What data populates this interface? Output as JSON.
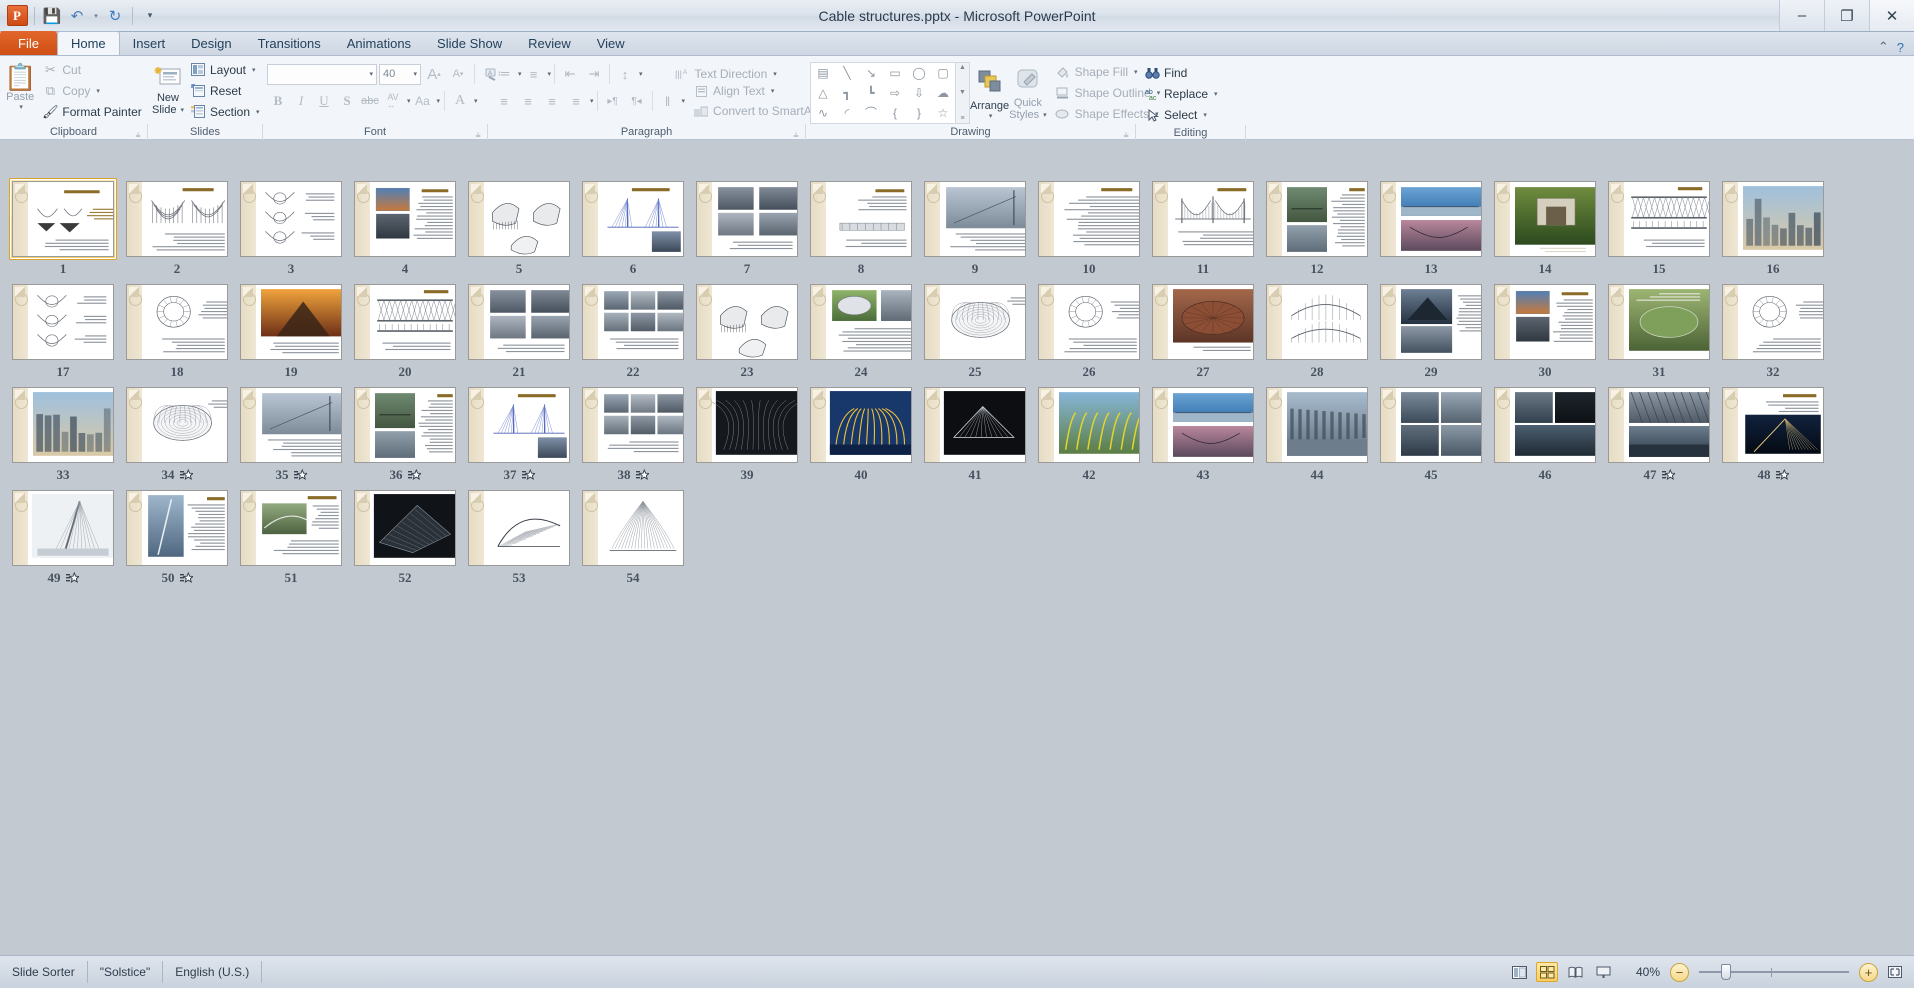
{
  "window": {
    "title": "Cable structures.pptx  -  Microsoft PowerPoint",
    "minimize": "–",
    "restore": "❐",
    "close": "✕"
  },
  "quick_access": {
    "logo": "P",
    "save": "💾",
    "undo": "↶",
    "undo_caret": "▾",
    "redo": "↻",
    "customize": "▾"
  },
  "tabs": [
    {
      "label": "File",
      "type": "file"
    },
    {
      "label": "Home",
      "type": "active"
    },
    {
      "label": "Insert",
      "type": "normal"
    },
    {
      "label": "Design",
      "type": "normal"
    },
    {
      "label": "Transitions",
      "type": "normal"
    },
    {
      "label": "Animations",
      "type": "normal"
    },
    {
      "label": "Slide Show",
      "type": "normal"
    },
    {
      "label": "Review",
      "type": "normal"
    },
    {
      "label": "View",
      "type": "normal"
    }
  ],
  "tab_right": {
    "help": "?",
    "minimize_ribbon": "⌃"
  },
  "ribbon": {
    "clipboard": {
      "group_label": "Clipboard",
      "dialog_launcher": "⫨",
      "paste": {
        "label": "Paste",
        "icon": "📋",
        "caret": "▾"
      },
      "cut": {
        "label": "Cut",
        "icon": "✂"
      },
      "copy": {
        "label": "Copy",
        "icon": "⧉",
        "caret": "▾"
      },
      "format_painter": {
        "label": "Format Painter",
        "icon": "🖌"
      }
    },
    "slides": {
      "group_label": "Slides",
      "new_slide": {
        "label_line1": "New",
        "label_line2": "Slide",
        "caret": "▾"
      },
      "layout": {
        "label": "Layout",
        "caret": "▾"
      },
      "reset": {
        "label": "Reset"
      },
      "section": {
        "label": "Section",
        "caret": "▾"
      }
    },
    "font": {
      "group_label": "Font",
      "dialog_launcher": "⫨",
      "font_name_value": "",
      "font_name_caret": "▾",
      "font_size_value": "40",
      "font_size_caret": "▾",
      "grow_font": "A↑",
      "shrink_font": "A↓",
      "clear_formatting": "⌫",
      "bold": "B",
      "italic": "I",
      "underline": "U",
      "shadow": "S",
      "strikethrough": "abc",
      "character_spacing": "AV",
      "change_case": "Aa",
      "font_color": "A"
    },
    "paragraph": {
      "group_label": "Paragraph",
      "dialog_launcher": "⫨",
      "bullets": "≔",
      "numbering": "≡",
      "decrease_indent": "⇤",
      "increase_indent": "⇥",
      "line_spacing": "↕",
      "align_left": "≡",
      "align_center": "≡",
      "align_right": "≡",
      "justify": "≡",
      "text_direction_ltr": "▸¶",
      "text_direction_rtl": "¶◂",
      "columns": "‖",
      "text_direction": {
        "label": "Text Direction",
        "caret": "▾"
      },
      "align_text": {
        "label": "Align Text",
        "caret": "▾"
      },
      "convert_smartart": {
        "label": "Convert to SmartArt",
        "caret": "▾"
      }
    },
    "drawing": {
      "group_label": "Drawing",
      "dialog_launcher": "⫨",
      "shapes": [
        "▤",
        "╲",
        "↘",
        "▭",
        "◯",
        "▢",
        "△",
        "┓",
        "┗",
        "⇨",
        "⇩",
        "☁",
        "∿",
        "◜",
        "⌒",
        "{",
        "}",
        "☆"
      ],
      "scroll_up": "▲",
      "scroll_dn": "▼",
      "scroll_more": "≡",
      "arrange": {
        "label": "Arrange",
        "caret": "▾"
      },
      "quick_styles": {
        "label_line1": "Quick",
        "label_line2": "Styles",
        "caret": "▾"
      },
      "shape_fill": {
        "label": "Shape Fill",
        "caret": "▾"
      },
      "shape_outline": {
        "label": "Shape Outline",
        "caret": "▾"
      },
      "shape_effects": {
        "label": "Shape Effects",
        "caret": "▾"
      }
    },
    "editing": {
      "group_label": "Editing",
      "find": {
        "label": "Find",
        "icon": "🔭"
      },
      "replace": {
        "label": "Replace",
        "icon": "ab",
        "caret": "▾"
      },
      "select": {
        "label": "Select",
        "icon": "➤",
        "caret": "▾"
      }
    }
  },
  "status_bar": {
    "view_name": "Slide Sorter",
    "theme": "\"Solstice\"",
    "language": "English (U.S.)",
    "zoom_level": "40%",
    "zoom_out": "−",
    "zoom_in": "+",
    "fit_to_window": "⛶",
    "views": [
      {
        "name": "normal-view",
        "glyph": "◫",
        "active": false
      },
      {
        "name": "slide-sorter-view",
        "glyph": "▦",
        "active": true
      },
      {
        "name": "reading-view",
        "glyph": "📖",
        "active": false
      },
      {
        "name": "slide-show-view",
        "glyph": "❐",
        "active": false
      }
    ]
  },
  "slides": [
    {
      "n": 1,
      "selected": true,
      "anim": false,
      "kind": "title-diagram"
    },
    {
      "n": 2,
      "selected": false,
      "anim": false,
      "kind": "sketch-pair"
    },
    {
      "n": 3,
      "selected": false,
      "anim": false,
      "kind": "sketch-col"
    },
    {
      "n": 4,
      "selected": false,
      "anim": false,
      "kind": "photo-text"
    },
    {
      "n": 5,
      "selected": false,
      "anim": false,
      "kind": "sketch-tents"
    },
    {
      "n": 6,
      "selected": false,
      "anim": false,
      "kind": "diagram-blue"
    },
    {
      "n": 7,
      "selected": false,
      "anim": false,
      "kind": "photo-grid"
    },
    {
      "n": 8,
      "selected": false,
      "anim": false,
      "kind": "text-diagram"
    },
    {
      "n": 9,
      "selected": false,
      "anim": false,
      "kind": "photo-wide"
    },
    {
      "n": 10,
      "selected": false,
      "anim": false,
      "kind": "text-only"
    },
    {
      "n": 11,
      "selected": false,
      "anim": false,
      "kind": "bridge-sketch"
    },
    {
      "n": 12,
      "selected": false,
      "anim": false,
      "kind": "photo-bridge"
    },
    {
      "n": 13,
      "selected": false,
      "anim": false,
      "kind": "photo-seabridge"
    },
    {
      "n": 14,
      "selected": false,
      "anim": false,
      "kind": "photo-green"
    },
    {
      "n": 15,
      "selected": false,
      "anim": false,
      "kind": "sketch-span"
    },
    {
      "n": 16,
      "selected": false,
      "anim": false,
      "kind": "photo-city"
    },
    {
      "n": 17,
      "selected": false,
      "anim": false,
      "kind": "sketch-col"
    },
    {
      "n": 18,
      "selected": false,
      "anim": false,
      "kind": "sketch-detail"
    },
    {
      "n": 19,
      "selected": false,
      "anim": false,
      "kind": "photo-sunset"
    },
    {
      "n": 20,
      "selected": false,
      "anim": false,
      "kind": "sketch-span"
    },
    {
      "n": 21,
      "selected": false,
      "anim": false,
      "kind": "photo-grid"
    },
    {
      "n": 22,
      "selected": false,
      "anim": false,
      "kind": "photo-grid2"
    },
    {
      "n": 23,
      "selected": false,
      "anim": false,
      "kind": "sketch-tents"
    },
    {
      "n": 24,
      "selected": false,
      "anim": false,
      "kind": "photo-stadium"
    },
    {
      "n": 25,
      "selected": false,
      "anim": false,
      "kind": "sketch-mesh"
    },
    {
      "n": 26,
      "selected": false,
      "anim": false,
      "kind": "sketch-detail"
    },
    {
      "n": 27,
      "selected": false,
      "anim": false,
      "kind": "photo-roof"
    },
    {
      "n": 28,
      "selected": false,
      "anim": false,
      "kind": "sketch-dome"
    },
    {
      "n": 29,
      "selected": false,
      "anim": false,
      "kind": "photo-dark"
    },
    {
      "n": 30,
      "selected": false,
      "anim": false,
      "kind": "photo-text"
    },
    {
      "n": 31,
      "selected": false,
      "anim": false,
      "kind": "photo-field"
    },
    {
      "n": 32,
      "selected": false,
      "anim": false,
      "kind": "sketch-detail"
    },
    {
      "n": 33,
      "selected": false,
      "anim": false,
      "kind": "photo-city"
    },
    {
      "n": 34,
      "selected": false,
      "anim": true,
      "kind": "sketch-mesh"
    },
    {
      "n": 35,
      "selected": false,
      "anim": true,
      "kind": "photo-wide"
    },
    {
      "n": 36,
      "selected": false,
      "anim": true,
      "kind": "photo-bridge"
    },
    {
      "n": 37,
      "selected": false,
      "anim": true,
      "kind": "diagram-blue"
    },
    {
      "n": 38,
      "selected": false,
      "anim": true,
      "kind": "photo-grid2"
    },
    {
      "n": 39,
      "selected": false,
      "anim": false,
      "kind": "photo-dark2"
    },
    {
      "n": 40,
      "selected": false,
      "anim": false,
      "kind": "photo-yellow"
    },
    {
      "n": 41,
      "selected": false,
      "anim": false,
      "kind": "photo-black"
    },
    {
      "n": 42,
      "selected": false,
      "anim": false,
      "kind": "photo-green2"
    },
    {
      "n": 43,
      "selected": false,
      "anim": false,
      "kind": "photo-seabridge"
    },
    {
      "n": 44,
      "selected": false,
      "anim": false,
      "kind": "photo-walkway"
    },
    {
      "n": 45,
      "selected": false,
      "anim": false,
      "kind": "photo-grid3"
    },
    {
      "n": 46,
      "selected": false,
      "anim": false,
      "kind": "photo-grid4"
    },
    {
      "n": 47,
      "selected": false,
      "anim": true,
      "kind": "photo-roof2"
    },
    {
      "n": 48,
      "selected": false,
      "anim": true,
      "kind": "photo-night"
    },
    {
      "n": 49,
      "selected": false,
      "anim": true,
      "kind": "photo-mast"
    },
    {
      "n": 50,
      "selected": false,
      "anim": true,
      "kind": "photo-tower"
    },
    {
      "n": 51,
      "selected": false,
      "anim": false,
      "kind": "photo-aerial"
    },
    {
      "n": 52,
      "selected": false,
      "anim": false,
      "kind": "photo-black2"
    },
    {
      "n": 53,
      "selected": false,
      "anim": false,
      "kind": "sketch-wing"
    },
    {
      "n": 54,
      "selected": false,
      "anim": false,
      "kind": "sketch-fan"
    }
  ]
}
